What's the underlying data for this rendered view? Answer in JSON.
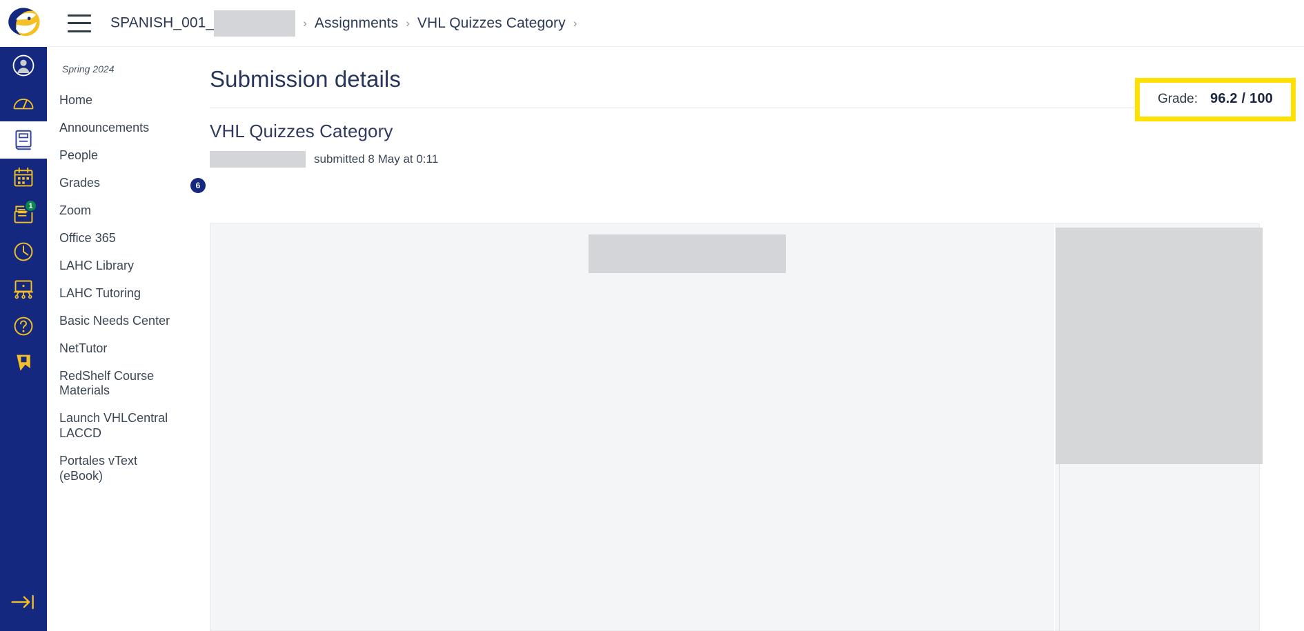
{
  "global_nav": {
    "logo": "eagle-logo",
    "items": [
      {
        "icon": "account-icon",
        "label": "Account",
        "badge": null,
        "active": false
      },
      {
        "icon": "dashboard-icon",
        "label": "Dashboard",
        "badge": null,
        "active": false
      },
      {
        "icon": "courses-icon",
        "label": "Courses",
        "badge": null,
        "active": true
      },
      {
        "icon": "calendar-icon",
        "label": "Calendar",
        "badge": null,
        "active": false
      },
      {
        "icon": "inbox-icon",
        "label": "Inbox",
        "badge": "1",
        "active": false
      },
      {
        "icon": "history-icon",
        "label": "History",
        "badge": null,
        "active": false
      },
      {
        "icon": "studio-icon",
        "label": "Studio",
        "badge": null,
        "active": false
      },
      {
        "icon": "help-icon",
        "label": "Help",
        "badge": null,
        "active": false
      },
      {
        "icon": "bookmark-icon",
        "label": "Bookmark",
        "badge": null,
        "active": false
      }
    ],
    "collapse": {
      "icon": "arrow-right-to-line-icon",
      "label": "Expand navigation"
    }
  },
  "topbar": {
    "menu_icon": "hamburger-icon",
    "breadcrumb": [
      {
        "text": "SPANISH_001_",
        "redacted": true
      },
      {
        "text": "Assignments",
        "redacted": false
      },
      {
        "text": "VHL Quizzes Category",
        "redacted": false
      }
    ],
    "separator": "›"
  },
  "course_nav": {
    "term": "Spring 2024",
    "items": [
      {
        "label": "Home",
        "badge": null
      },
      {
        "label": "Announcements",
        "badge": null
      },
      {
        "label": "People",
        "badge": null
      },
      {
        "label": "Grades",
        "badge": "6"
      },
      {
        "label": "Zoom",
        "badge": null
      },
      {
        "label": "Office 365",
        "badge": null
      },
      {
        "label": "LAHC Library",
        "badge": null
      },
      {
        "label": "LAHC Tutoring",
        "badge": null
      },
      {
        "label": "Basic Needs Center",
        "badge": null
      },
      {
        "label": "NetTutor",
        "badge": null
      },
      {
        "label": "RedShelf Course Materials",
        "badge": null
      },
      {
        "label": "Launch VHLCentral LACCD",
        "badge": null
      },
      {
        "label": "Portales vText (eBook)",
        "badge": null
      }
    ]
  },
  "main": {
    "page_title": "Submission details",
    "assignment_title": "VHL Quizzes Category",
    "submitted_text": "submitted 8 May at 0:11",
    "submitter_redacted": true,
    "grade": {
      "label": "Grade:",
      "value": "96.2 / 100",
      "score": "96.2",
      "out_of": "100",
      "highlight_color": "#ffe000"
    },
    "preview": {
      "description": "submission-preview-panel",
      "redacted_regions": 2
    }
  },
  "colors": {
    "global_nav_bg": "#13287e",
    "accent_yellow": "#f5c024",
    "highlight": "#ffe000",
    "badge_green": "#0b874b",
    "text_primary": "#2d3b45",
    "heading": "#27355b"
  }
}
